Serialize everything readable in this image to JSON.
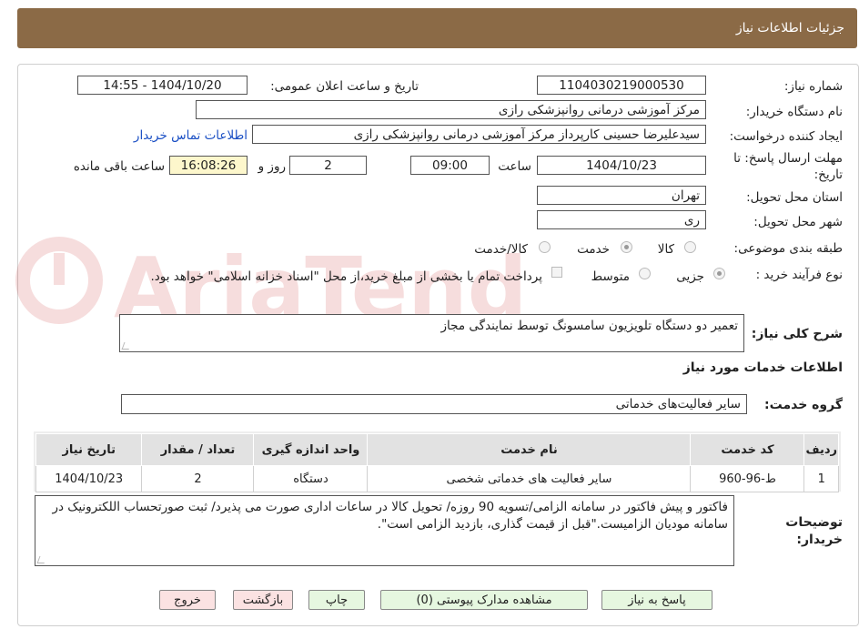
{
  "header": {
    "title": "جزئیات اطلاعات نیاز"
  },
  "form": {
    "need_number_label": "شماره نیاز:",
    "need_number": "1104030219000530",
    "announce_label": "تاریخ و ساعت اعلان عمومی:",
    "announce_value": "1404/10/20 - 14:55",
    "buyer_org_label": "نام دستگاه خریدار:",
    "buyer_org": "مرکز آموزشی درمانی روانپزشکی رازی",
    "creator_label": "ایجاد کننده درخواست:",
    "creator": "سیدعلیرضا حسینی کارپرداز مرکز آموزشی درمانی روانپزشکی رازی",
    "contact_link": "اطلاعات تماس خریدار",
    "deadline_label_1": "مهلت ارسال پاسخ: تا",
    "deadline_label_2": "تاریخ:",
    "deadline_date": "1404/10/23",
    "time_label": "ساعت",
    "deadline_time": "09:00",
    "days_value": "2",
    "days_label": "روز و",
    "remaining_time": "16:08:26",
    "remaining_label": "ساعت باقی مانده",
    "province_label": "استان محل تحویل:",
    "province": "تهران",
    "city_label": "شهر محل تحویل:",
    "city": "ری",
    "category_label": "طبقه بندی موضوعی:",
    "category_options": [
      "کالا",
      "خدمت",
      "کالا/خدمت"
    ],
    "process_label": "نوع فرآیند خرید :",
    "process_options": [
      "جزیی",
      "متوسط"
    ],
    "payment_note": "پرداخت تمام یا بخشی از مبلغ خرید،از محل \"اسناد خزانه اسلامی\" خواهد بود.",
    "description_label": "شرح کلی نیاز:",
    "description": "تعمیر دو دستگاه تلویزیون سامسونگ توسط نمایندگی مجاز",
    "services_heading": "اطلاعات خدمات مورد نیاز",
    "service_group_label": "گروه خدمت:",
    "service_group": "سایر فعالیت‌های خدماتی"
  },
  "table": {
    "headers": [
      "ردیف",
      "کد خدمت",
      "نام خدمت",
      "واحد اندازه گیری",
      "تعداد / مقدار",
      "تاریخ نیاز"
    ],
    "rows": [
      [
        "1",
        "ط-96-960",
        "سایر فعالیت های خدماتی شخصی",
        "دستگاه",
        "2",
        "1404/10/23"
      ]
    ]
  },
  "buyer_notes": {
    "label_1": "توضیحات",
    "label_2": "خریدار:",
    "text": "فاکتور و پیش فاکتور در سامانه الزامی/تسویه 90 روزه/ تحویل کالا در ساعات اداری صورت می پذیرد/ ثبت صورتحساب اللکترونیک در سامانه مودیان الزامیست.\"قبل از قیمت گذاری، بازدید الزامی است\"."
  },
  "buttons": {
    "reply": "پاسخ به نیاز",
    "attachments": "مشاهده مدارک پیوستی (0)",
    "print": "چاپ",
    "back": "بازگشت",
    "exit": "خروج"
  }
}
